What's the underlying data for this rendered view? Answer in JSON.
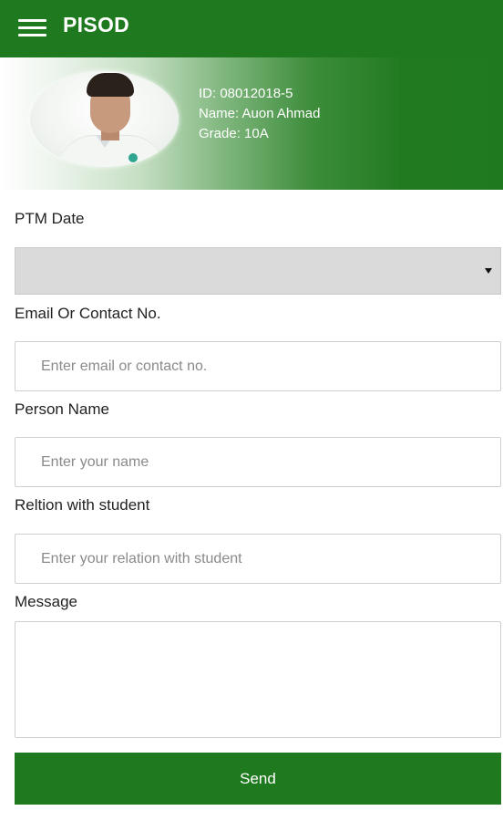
{
  "appbar": {
    "title": "PISOD",
    "menu_icon": "hamburger-menu-icon",
    "background_color": "#1f7a1f"
  },
  "student": {
    "id_text": "ID: 08012018-5",
    "name_text": "Name: Auon Ahmad",
    "grade_text": "Grade: 10A"
  },
  "form": {
    "ptm_date_label": "PTM Date",
    "ptm_date_value": "",
    "email_label": "Email Or Contact No.",
    "email_placeholder": "Enter email or contact no.",
    "email_value": "",
    "person_name_label": "Person Name",
    "person_name_placeholder": "Enter your name",
    "person_name_value": "",
    "relation_label": "Reltion with student",
    "relation_placeholder": "Enter your relation with student",
    "relation_value": "",
    "message_label": "Message",
    "message_value": "",
    "send_label": "Send"
  },
  "colors": {
    "primary": "#1f7a1f",
    "select_background": "#dadada"
  }
}
